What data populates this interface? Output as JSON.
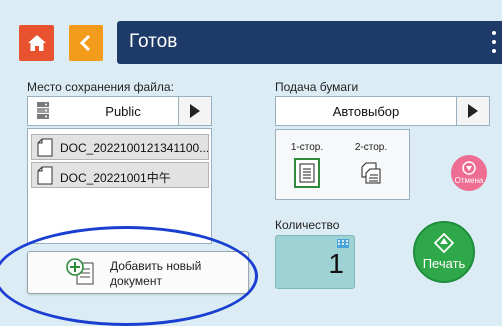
{
  "header": {
    "title": "Готов"
  },
  "save_location": {
    "label": "Место сохранения файла:",
    "value": "Public"
  },
  "files": [
    {
      "name": "DOC_2022100121341100..."
    },
    {
      "name": "DOC_20221001中午"
    }
  ],
  "add_document": {
    "label": "Добавить новый документ"
  },
  "paper_feed": {
    "label": "Подача бумаги",
    "value": "Автовыбор"
  },
  "duplex": {
    "one_sided_label": "1-стор.",
    "two_sided_label": "2-стор."
  },
  "cancel": {
    "label": "Отмена"
  },
  "quantity": {
    "label": "Количество",
    "value": "1"
  },
  "print": {
    "label": "Печать"
  },
  "colors": {
    "header_bg": "#1e3a68",
    "home": "#e8522f",
    "back": "#f39c1b",
    "print": "#2fa84a",
    "cancel": "#ee6d92",
    "annotation": "#1a3fd0"
  }
}
